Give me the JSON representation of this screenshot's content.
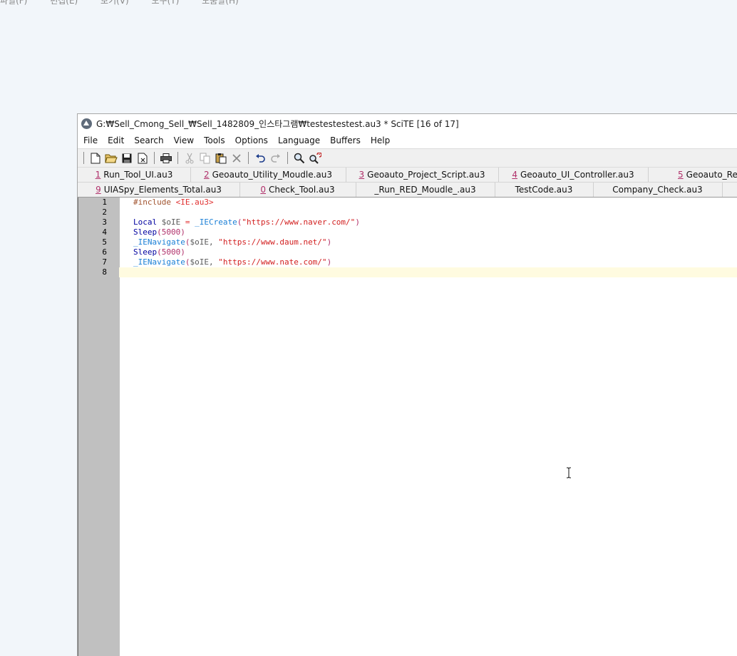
{
  "background_menu": [
    "파일(F)",
    "편집(E)",
    "보기(V)",
    "도구(T)",
    "도움말(H)"
  ],
  "window": {
    "title": "G:₩Sell_Cmong_Sell_₩Sell_1482809_인스타그램₩testestestest.au3 * SciTE [16 of 17]"
  },
  "menu": [
    "File",
    "Edit",
    "Search",
    "View",
    "Tools",
    "Options",
    "Language",
    "Buffers",
    "Help"
  ],
  "toolbar_icons": [
    "new-file-icon",
    "open-folder-icon",
    "save-icon",
    "close-file-icon",
    "print-icon",
    "cut-icon",
    "copy-icon",
    "paste-icon",
    "delete-icon",
    "undo-icon",
    "redo-icon",
    "find-icon",
    "replace-icon"
  ],
  "tabs_row1": [
    {
      "num": "1",
      "label": "Run_Tool_UI.au3"
    },
    {
      "num": "2",
      "label": "Geoauto_Utility_Moudle.au3"
    },
    {
      "num": "3",
      "label": "Geoauto_Project_Script.au3"
    },
    {
      "num": "4",
      "label": "Geoauto_UI_Controller.au3"
    },
    {
      "num": "5",
      "label": "Geoauto_Repo"
    }
  ],
  "tabs_row2": [
    {
      "num": "9",
      "label": "UIASpy_Elements_Total.au3"
    },
    {
      "num": "0",
      "label": "Check_Tool.au3"
    },
    {
      "num": "",
      "label": "_Run_RED_Moudle_.au3"
    },
    {
      "num": "",
      "label": "TestCode.au3"
    },
    {
      "num": "",
      "label": "Company_Check.au3"
    }
  ],
  "line_numbers": [
    "1",
    "2",
    "3",
    "4",
    "5",
    "6",
    "7",
    "8"
  ],
  "code": {
    "l1_directive": "#include",
    "l1_file": "<IE.au3>",
    "l3_kw": "Local",
    "l3_var": "$oIE",
    "l3_op": "=",
    "l3_fn": "_IECreate",
    "l3_str": "\"https://www.naver.com/\"",
    "l4_fn": "Sleep",
    "l4_num": "5000",
    "l5_fn": "_IENavigate",
    "l5_var": "$oIE",
    "l5_str": "\"https://www.daum.net/\"",
    "l6_fn": "Sleep",
    "l6_num": "5000",
    "l7_fn": "_IENavigate",
    "l7_var": "$oIE",
    "l7_str": "\"https://www.nate.com/\""
  }
}
